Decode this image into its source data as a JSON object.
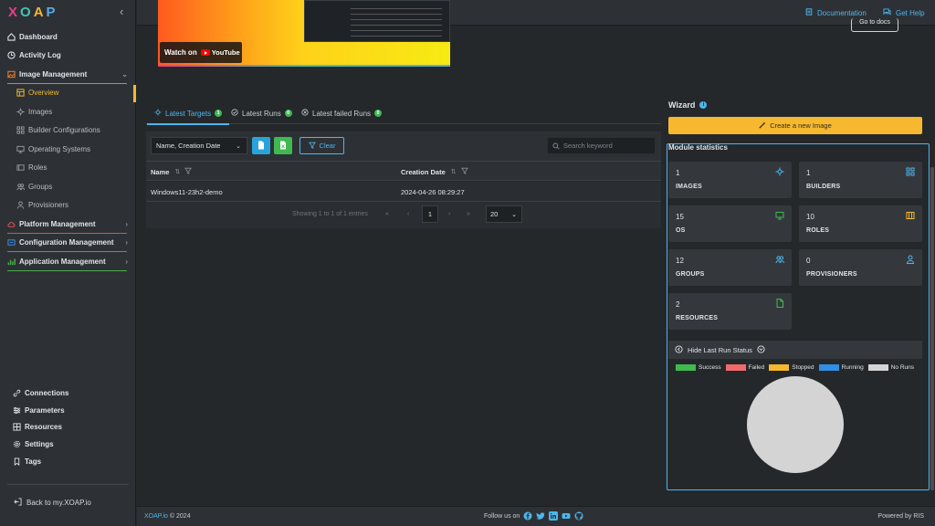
{
  "sidebar": {
    "logo": {
      "x": "X",
      "o": "O",
      "a": "A",
      "p": "P"
    },
    "items": [
      {
        "label": "Dashboard"
      },
      {
        "label": "Activity Log"
      },
      {
        "label": "Image Management"
      },
      {
        "label": "Overview"
      },
      {
        "label": "Images"
      },
      {
        "label": "Builder Configurations"
      },
      {
        "label": "Operating Systems"
      },
      {
        "label": "Roles"
      },
      {
        "label": "Groups"
      },
      {
        "label": "Provisioners"
      },
      {
        "label": "Platform Management"
      },
      {
        "label": "Configuration Management"
      },
      {
        "label": "Application Management"
      }
    ],
    "bottom_items": [
      {
        "label": "Connections"
      },
      {
        "label": "Parameters"
      },
      {
        "label": "Resources"
      },
      {
        "label": "Settings"
      },
      {
        "label": "Tags"
      }
    ],
    "back_link": "Back to my.XOAP.io"
  },
  "topbar": {
    "documentation": "Documentation",
    "get_help": "Get Help"
  },
  "video": {
    "watch_on": "Watch on",
    "youtube": "YouTube"
  },
  "docs_button": "Go to docs",
  "tabs": [
    {
      "label": "Latest Targets",
      "count": "1"
    },
    {
      "label": "Latest Runs",
      "count": "0"
    },
    {
      "label": "Latest failed Runs",
      "count": "0"
    }
  ],
  "toolbar": {
    "sort_select": "Name, Creation Date",
    "clear_label": "Clear",
    "search_placeholder": "Search keyword"
  },
  "table": {
    "columns": [
      "Name",
      "Creation Date"
    ],
    "rows": [
      [
        "Windows11-23h2-demo",
        "2024-04-26 08:29:27"
      ]
    ]
  },
  "pagination": {
    "info": "Showing 1 to 1 of 1 entries",
    "current_page": "1",
    "page_size": "20",
    "first": "«",
    "prev": "‹",
    "next": "›",
    "last": "»"
  },
  "wizard": {
    "title": "Wizard",
    "info": "i",
    "create_label": "Create a new Image"
  },
  "module_statistics": {
    "title": "Module statistics",
    "cards": [
      {
        "value": "1",
        "label": "IMAGES"
      },
      {
        "value": "1",
        "label": "BUILDERS"
      },
      {
        "value": "15",
        "label": "OS"
      },
      {
        "value": "10",
        "label": "ROLES"
      },
      {
        "value": "12",
        "label": "GROUPS"
      },
      {
        "value": "0",
        "label": "PROVISIONERS"
      },
      {
        "value": "2",
        "label": "RESOURCES"
      }
    ]
  },
  "last_run_status": {
    "toggle_label": "Hide Last Run Status",
    "legend": [
      {
        "label": "Success",
        "color": "#3fb950"
      },
      {
        "label": "Failed",
        "color": "#f06a6a"
      },
      {
        "label": "Stopped",
        "color": "#f5b82e"
      },
      {
        "label": "Running",
        "color": "#2f8fe6"
      },
      {
        "label": "No Runs",
        "color": "#d4d4d4"
      }
    ]
  },
  "footer": {
    "brand": "XOAP.io",
    "copyright": "© 2024",
    "follow": "Follow us on",
    "powered": "Powered by RIS"
  },
  "colors": {
    "accent": "#f5b82e",
    "link": "#4db6ee",
    "success": "#3fb950"
  }
}
